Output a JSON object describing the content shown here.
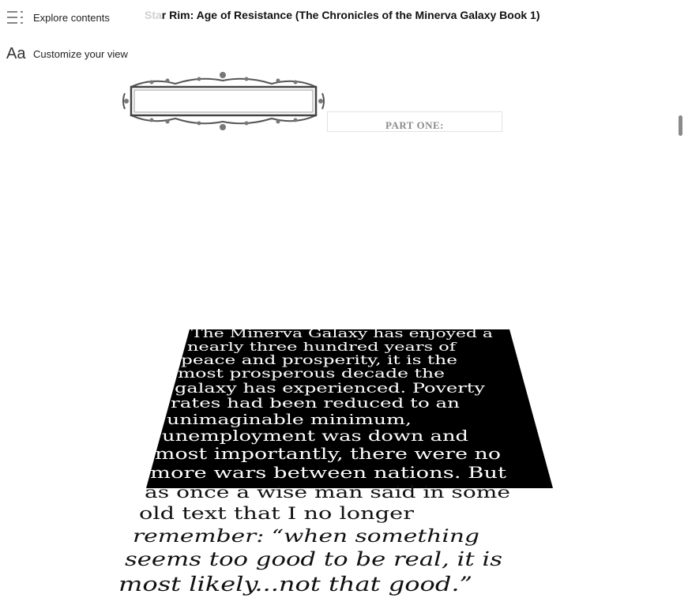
{
  "sidebar": {
    "explore_contents": "Explore contents",
    "customize_view": "Customize your view",
    "customize_icon_glyph": "Aa",
    "icons": [
      "contents-list-icon",
      "text-size-icon"
    ]
  },
  "book": {
    "title_faded": "Sta",
    "title_main": "r Rim: Age of Resistance (The Chronicles of the Minerva Galaxy Book 1)"
  },
  "page": {
    "part_heading": "PART ONE:",
    "crawl_lines": [
      "The Minerva Galaxy has enjoyed a",
      "nearly three hundred years of",
      "peace and prosperity, it is the",
      "most prosperous decade the",
      "galaxy has experienced. Poverty",
      "rates had been reduced to an",
      "unimaginable minimum,",
      "unemployment was down and",
      "most importantly, there were no",
      "more wars between nations. But",
      "as once a wise man said in some",
      "old text that I no longer",
      "remember: “when something",
      "seems too good to be real, it is",
      "most likely...not that good.”"
    ]
  },
  "colors": {
    "crawl_background": "#000000",
    "crawl_text_dark_bg": "#ffffff",
    "crawl_text_light_bg": "#111111",
    "part_heading": "#8c8c8c",
    "title_faded": "#cfcfcf"
  }
}
